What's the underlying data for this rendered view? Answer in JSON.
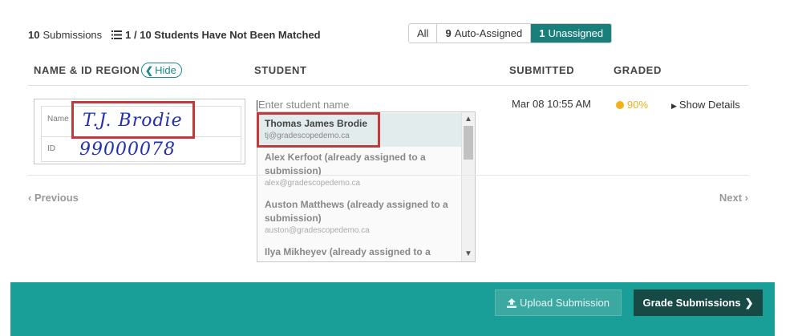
{
  "header": {
    "submissions_count": "10",
    "submissions_label": "Submissions",
    "match_info": "1 / 10 Students Have Not Been Matched",
    "list_icon": "list-icon"
  },
  "filters": [
    {
      "count": "",
      "label": "All",
      "active": false
    },
    {
      "count": "9",
      "label": "Auto-Assigned",
      "active": false
    },
    {
      "count": "1",
      "label": "Unassigned",
      "active": true
    }
  ],
  "columns": {
    "name_id_region": "NAME & ID REGION",
    "hide_label": "Hide",
    "student": "STUDENT",
    "submitted": "SUBMITTED",
    "graded": "GRADED"
  },
  "id_region": {
    "name_label": "Name",
    "id_label": "ID",
    "handwritten_name": "T.J. Brodie",
    "handwritten_id": "99000078"
  },
  "student_field": {
    "placeholder": "Enter student name"
  },
  "dropdown": {
    "items": [
      {
        "name": "Thomas James Brodie",
        "email": "tj@gradescopedemo.ca",
        "selected": true
      },
      {
        "name": "Alex Kerfoot (already assigned to a",
        "name2": "submission)",
        "email": "alex@gradescopedemo.ca"
      },
      {
        "name": "Auston Matthews (already assigned to a",
        "name2": "submission)",
        "email": "auston@gradescopedemo.ca"
      },
      {
        "name": "Ilya Mikheyev (already assigned to a"
      }
    ]
  },
  "row": {
    "submitted": "Mar 08 10:55 AM",
    "graded": "90%",
    "details": "Show Details"
  },
  "pagination": {
    "previous": "Previous",
    "next": "Next"
  },
  "footer": {
    "upload_label": "Upload Submission",
    "grade_label": "Grade Submissions"
  },
  "colors": {
    "accent": "#1a9e98",
    "active_filter": "#1a7f7b",
    "highlight_box": "#c0393b",
    "graded": "#f0b11a"
  }
}
